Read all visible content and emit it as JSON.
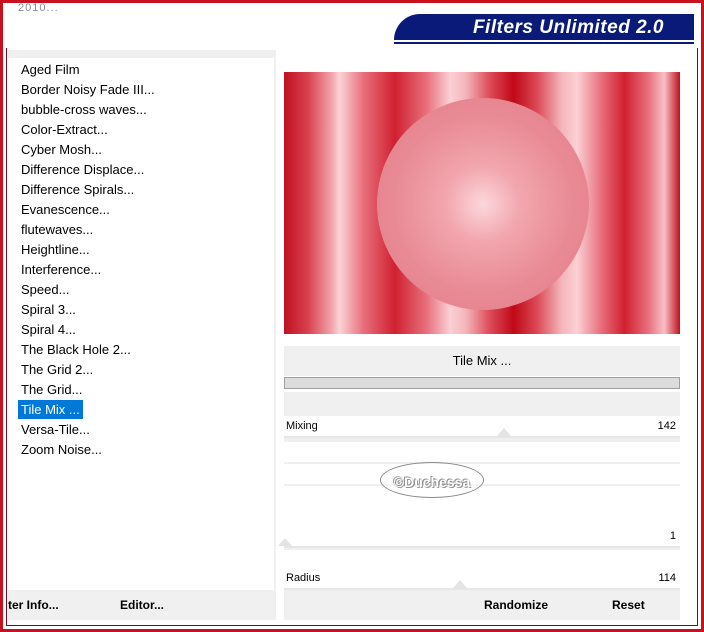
{
  "window": {
    "title_fragment": "2010...",
    "banner": "Filters Unlimited 2.0"
  },
  "filter_list": {
    "items": [
      {
        "label": "Aged Film",
        "selected": false
      },
      {
        "label": "Border Noisy Fade III...",
        "selected": false
      },
      {
        "label": "bubble-cross waves...",
        "selected": false
      },
      {
        "label": "Color-Extract...",
        "selected": false
      },
      {
        "label": "Cyber Mosh...",
        "selected": false
      },
      {
        "label": "Difference Displace...",
        "selected": false
      },
      {
        "label": "Difference Spirals...",
        "selected": false
      },
      {
        "label": "Evanescence...",
        "selected": false
      },
      {
        "label": "flutewaves...",
        "selected": false
      },
      {
        "label": "Heightline...",
        "selected": false
      },
      {
        "label": "Interference...",
        "selected": false
      },
      {
        "label": "Speed...",
        "selected": false
      },
      {
        "label": "Spiral 3...",
        "selected": false
      },
      {
        "label": "Spiral 4...",
        "selected": false
      },
      {
        "label": "The Black Hole 2...",
        "selected": false
      },
      {
        "label": "The Grid 2...",
        "selected": false
      },
      {
        "label": "The Grid...",
        "selected": false
      },
      {
        "label": "Tile Mix ...",
        "selected": true
      },
      {
        "label": "Versa-Tile...",
        "selected": false
      },
      {
        "label": "Zoom Noise...",
        "selected": false
      }
    ]
  },
  "current_filter": "Tile Mix ...",
  "controls": {
    "mixing": {
      "label": "Mixing",
      "value": "142"
    },
    "unnamed_slider": {
      "label": "",
      "value": "1"
    },
    "radius": {
      "label": "Radius",
      "value": "114"
    }
  },
  "watermark": "©Duchessa",
  "footer": {
    "filter_info_label": "ter Info...",
    "editor_label": "Editor...",
    "randomize_label": "Randomize",
    "reset_label": "Reset"
  },
  "colors": {
    "frame": "#c8101e",
    "banner_bg": "#0a1a78",
    "selection": "#0078d7",
    "preview_red": "#c01020"
  }
}
